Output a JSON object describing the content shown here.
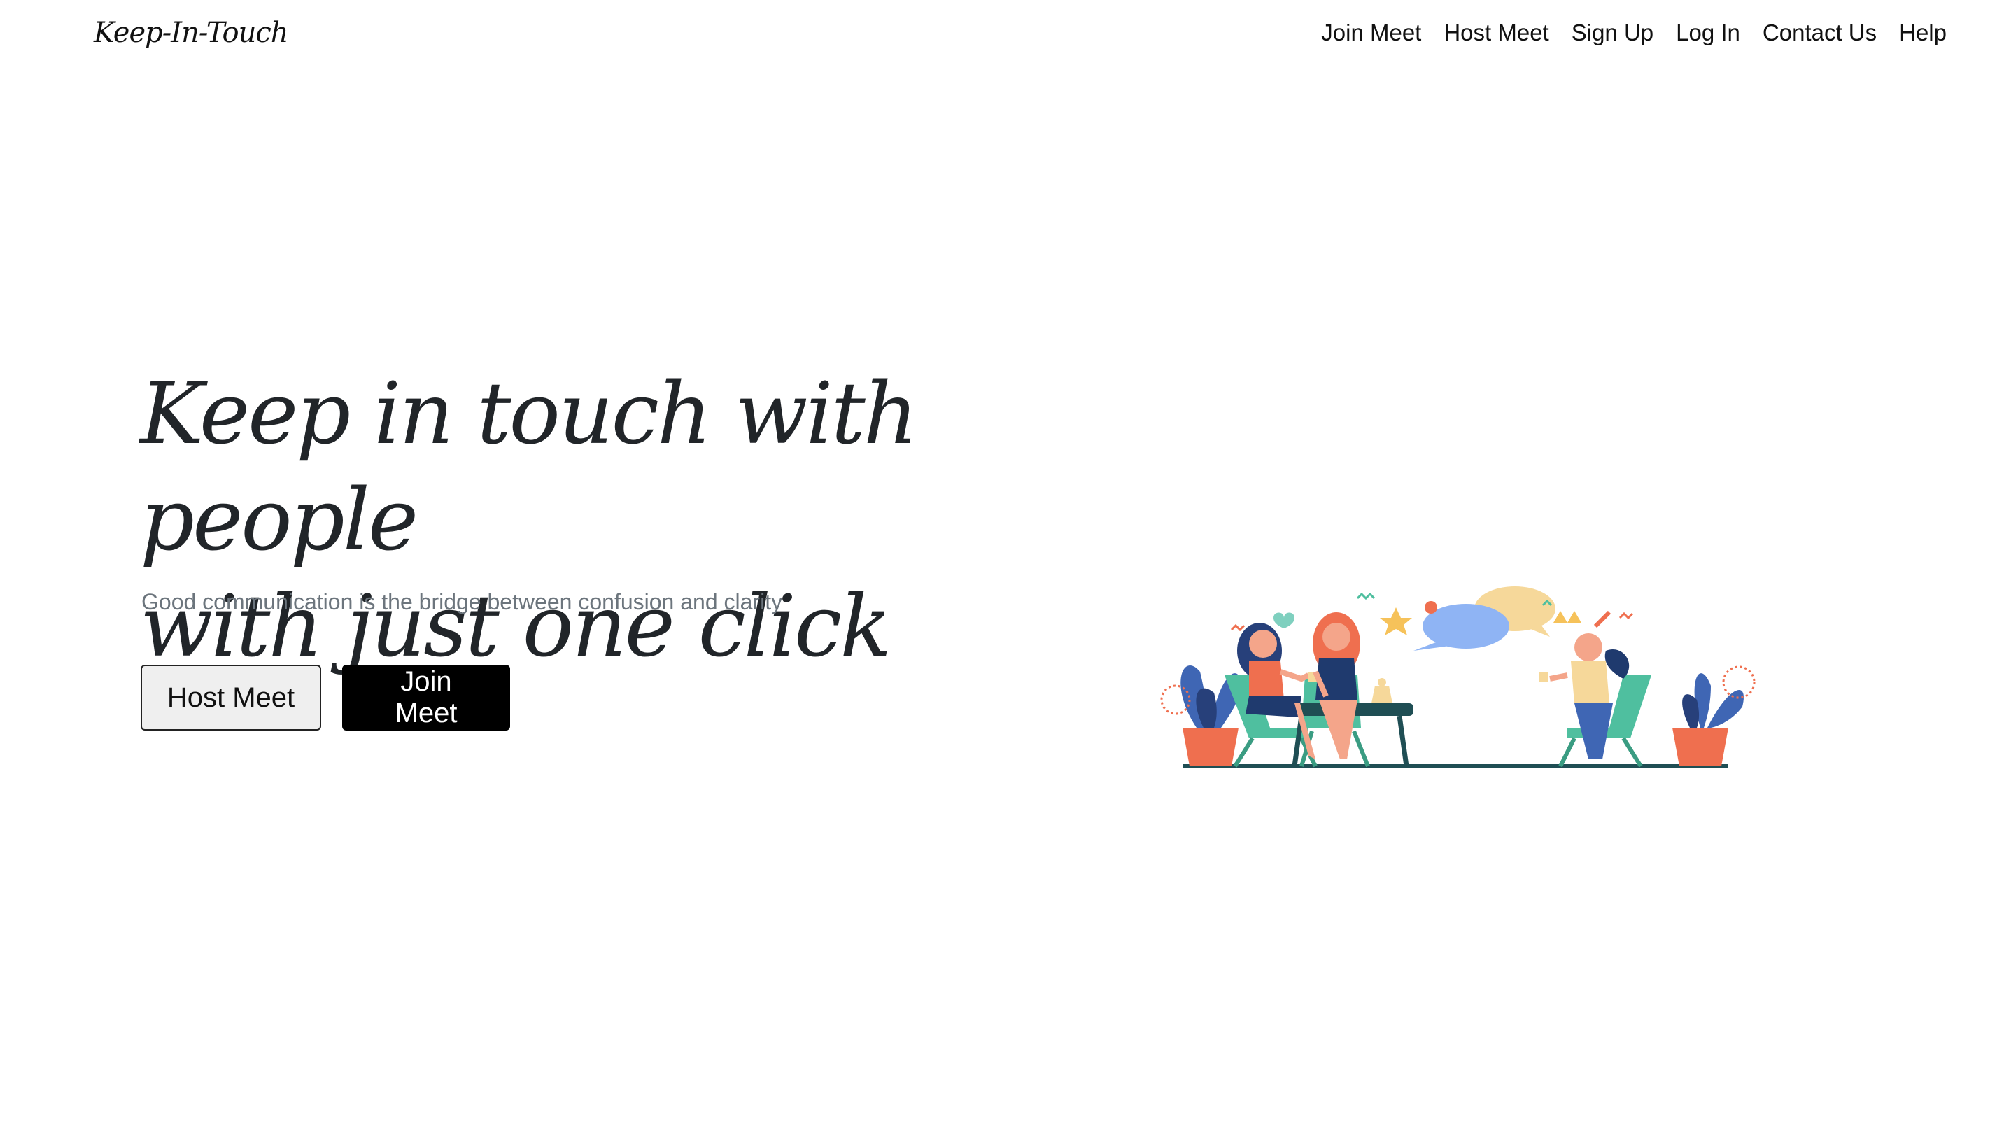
{
  "brand": {
    "name": "Keep-In-Touch"
  },
  "nav": {
    "items": [
      {
        "label": "Join Meet"
      },
      {
        "label": "Host Meet"
      },
      {
        "label": "Sign Up"
      },
      {
        "label": "Log In"
      },
      {
        "label": "Contact Us"
      },
      {
        "label": "Help"
      }
    ]
  },
  "hero": {
    "title_line1": "Keep in touch with people",
    "title_line2": "with just one click",
    "subtitle": "Good communication is the bridge between confusion and clarity",
    "host_button": "Host Meet",
    "join_button": "Join Meet"
  },
  "illustration": {
    "icon": "friends-meeting-illustration",
    "colors": {
      "chair": "#4fbf9f",
      "table": "#1f4e54",
      "pot": "#ef6f4f",
      "leaf": "#3f66b4",
      "hair_dark": "#27407a",
      "hair_red": "#ef6f4f",
      "bubble_blue": "#8fb4f4",
      "bubble_yellow": "#f6d89a",
      "skin": "#f4a58a"
    }
  }
}
